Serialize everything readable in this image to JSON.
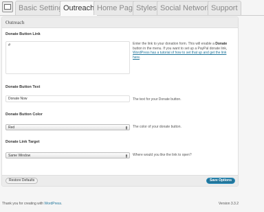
{
  "tabs": [
    {
      "label": "Basic Settings",
      "active": false
    },
    {
      "label": "Outreach",
      "active": true
    },
    {
      "label": "Home Page",
      "active": false
    },
    {
      "label": "Styles",
      "active": false
    },
    {
      "label": "Social Networks",
      "active": false
    },
    {
      "label": "Support",
      "active": false
    }
  ],
  "panel": {
    "title": "Outreach",
    "donate_link": {
      "label": "Donate Button Link",
      "value": "#",
      "help_pre": "Enter the link to your donation form. This will enable a ",
      "help_bold": "Donate",
      "help_mid": " button in the menu. If you want to set up a PayPal donate link, ",
      "help_link": "WordPress has a tutorial of how to set that up and get the link here",
      "help_end": "."
    },
    "donate_text": {
      "label": "Donate Button Text",
      "value": "Donate Now",
      "help": "The text for your Donate button."
    },
    "donate_color": {
      "label": "Donate Button Color",
      "value": "Red",
      "help": "The color of your donate button."
    },
    "link_target": {
      "label": "Donate Link Target",
      "value": "Same Window",
      "help": "Where would you like the link to open?"
    },
    "reset_label": "Restore Defaults",
    "save_label": "Save Options"
  },
  "footer": {
    "thanks_pre": "Thank you for creating with ",
    "thanks_link": "WordPress",
    "thanks_end": ".",
    "version": "Version 3.3.2"
  },
  "colors": {
    "accent": "#21759b",
    "link": "#21759b"
  },
  "icons": {
    "tab_icon": "settings-screen-icon",
    "select_arrow": "up-down-arrows-icon"
  }
}
